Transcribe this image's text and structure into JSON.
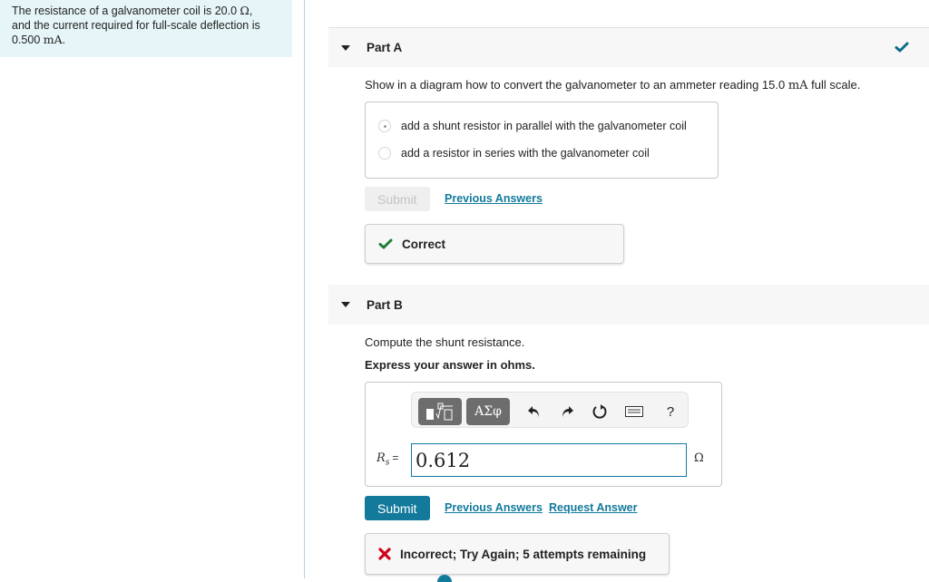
{
  "problem": {
    "line1_prefix": "The resistance of a galvanometer coil is 20.0 ",
    "line1_unit": "Ω",
    "line1_suffix": ",",
    "line2": "and the current required for full-scale deflection is",
    "line3_value": "0.500 ",
    "line3_unit": "mA",
    "line3_suffix": "."
  },
  "part_a": {
    "title": "Part A",
    "status_icon": "checkmark-icon",
    "status_color": "#0e6c89",
    "question_prefix": "Show in a diagram how to convert the galvanometer to an ammeter reading 15.0 ",
    "question_unit": "mA",
    "question_suffix": " full scale.",
    "choices": [
      {
        "label": "add a shunt resistor in parallel with the galvanometer coil",
        "selected": true
      },
      {
        "label": "add a resistor in series with the galvanometer coil",
        "selected": false
      }
    ],
    "submit_label": "Submit",
    "submit_disabled": true,
    "previous_answers_label": "Previous Answers",
    "feedback": {
      "icon": "checkmark-icon",
      "text": "Correct",
      "color": "#1e7e34"
    }
  },
  "part_b": {
    "title": "Part B",
    "question": "Compute the shunt resistance.",
    "instruction": "Express your answer in ohms.",
    "toolbar": {
      "templates_icon": "templates-icon",
      "symbols_label": "ΑΣφ",
      "undo_icon": "undo-icon",
      "redo_icon": "redo-icon",
      "reset_icon": "reset-icon",
      "keyboard_icon": "keyboard-icon",
      "help_label": "?"
    },
    "variable": "R",
    "variable_sub": "s",
    "equals": "=",
    "answer_value": "0.612",
    "unit": "Ω",
    "submit_label": "Submit",
    "previous_answers_label": "Previous Answers",
    "request_answer_label": "Request Answer",
    "feedback": {
      "icon": "x-mark-icon",
      "text": "Incorrect; Try Again; 5 attempts remaining",
      "color": "#d0021b"
    }
  },
  "colors": {
    "accent": "#137a9c",
    "problem_bg": "#e6f5f7",
    "header_bg": "#f7f7f7"
  }
}
